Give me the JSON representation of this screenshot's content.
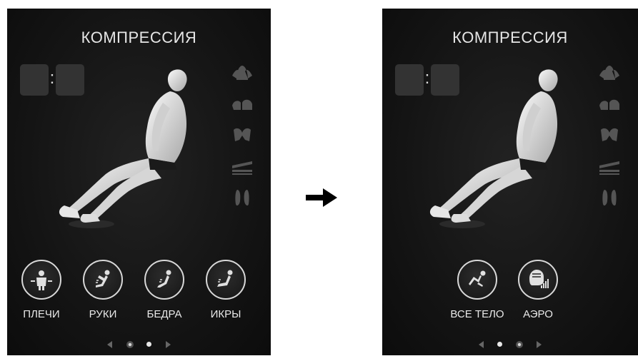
{
  "screens": [
    {
      "title": "КОМПРЕССИЯ",
      "timer": {
        "separator": ":"
      },
      "zone_icons": [
        "shoulders-zone-icon",
        "arms-zone-icon",
        "hips-zone-icon",
        "calves-zone-icon",
        "feet-zone-icon"
      ],
      "modes": [
        {
          "label": "ПЛЕЧИ",
          "icon": "shoulders-icon"
        },
        {
          "label": "РУКИ",
          "icon": "arms-icon"
        },
        {
          "label": "БЕДРА",
          "icon": "hips-icon"
        },
        {
          "label": "ИКРЫ",
          "icon": "calves-icon"
        }
      ],
      "pager": {
        "pages": 2,
        "active_page": 1
      }
    },
    {
      "title": "КОМПРЕССИЯ",
      "timer": {
        "separator": ":"
      },
      "zone_icons": [
        "shoulders-zone-icon",
        "arms-zone-icon",
        "hips-zone-icon",
        "calves-zone-icon",
        "feet-zone-icon"
      ],
      "modes": [
        {
          "label": "ВСЕ ТЕЛО",
          "icon": "full-body-icon"
        },
        {
          "label": "АЭРО",
          "icon": "air-intensity-icon"
        }
      ],
      "pager": {
        "pages": 2,
        "active_page": 2
      }
    }
  ],
  "transition_arrow": "right-arrow-icon",
  "colors": {
    "screen_bg": "#141414",
    "text": "#e6e6e6",
    "ring": "#d8d8d8",
    "timer_box": "#333333",
    "zone_icon": "#555555"
  }
}
